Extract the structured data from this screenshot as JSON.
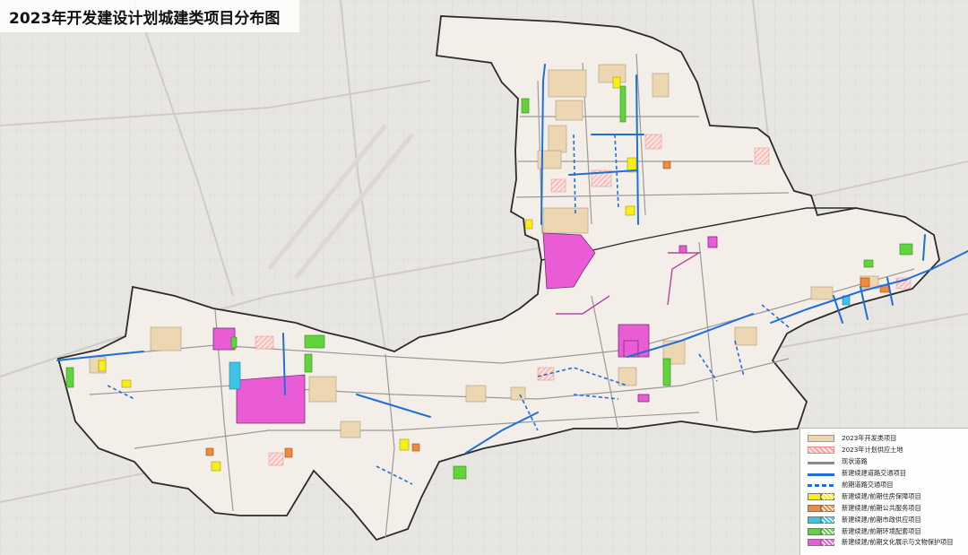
{
  "title": "2023年开发建设计划城建类项目分布图",
  "legend": {
    "items": [
      {
        "label": "2023年开发类项目",
        "kind": "fill",
        "color": "#ecd7b2",
        "border": "#999999"
      },
      {
        "label": "2023年计划供应土地",
        "kind": "hatch",
        "color": "#f4a7a3"
      },
      {
        "label": "现状道路",
        "kind": "line",
        "color": "#8a8a8a"
      },
      {
        "label": "新建续建道路交通项目",
        "kind": "line",
        "color": "#1f6fd6"
      },
      {
        "label": "前期道路交通项目",
        "kind": "dash",
        "color": "#1f6fd6"
      },
      {
        "label": "新建续建/前期住房保障项目",
        "kind": "split",
        "color": "#f7ee1e"
      },
      {
        "label": "新建续建/前期公共服务项目",
        "kind": "split",
        "color": "#f08a3c"
      },
      {
        "label": "新建续建/前期市政供应项目",
        "kind": "split",
        "color": "#3cc4e8"
      },
      {
        "label": "新建续建/前期环境配套项目",
        "kind": "split",
        "color": "#62d33d"
      },
      {
        "label": "新建续建/前期文化展示与文物保护项目",
        "kind": "split",
        "color": "#e95cd6"
      }
    ]
  },
  "colors": {
    "boundary": "#2b2b2b",
    "district_fill": "#f3efe8",
    "background": "#e8e6e3",
    "magenta": "#e95cd6",
    "cyan": "#3cc4e8",
    "green": "#62d33d",
    "yellow": "#f7ee1e",
    "orange": "#f08a3c",
    "blue_road": "#1f6fd6",
    "dev": "#ecd7b2",
    "grey_road": "#8a8a8a"
  }
}
